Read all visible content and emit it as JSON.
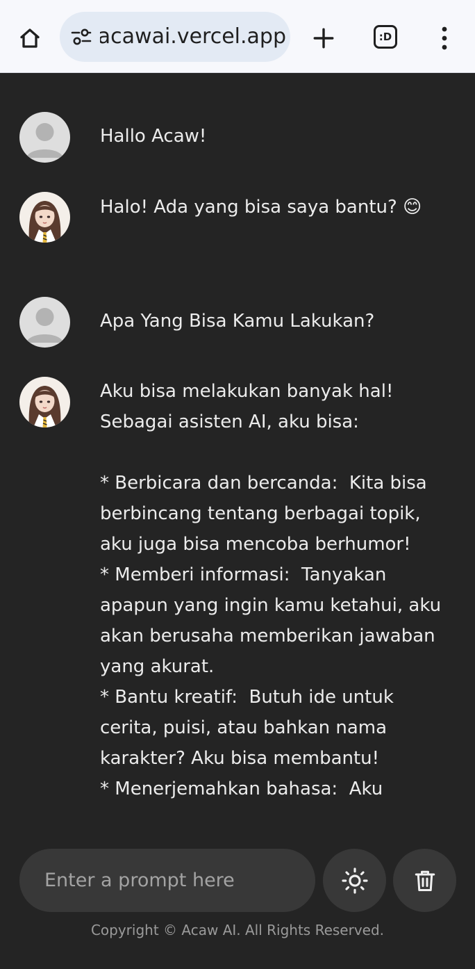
{
  "browser": {
    "url": "acawai.vercel.app",
    "tabs_label": ":D"
  },
  "chat": {
    "messages": [
      {
        "role": "user",
        "text": "Hallo Acaw!"
      },
      {
        "role": "assistant",
        "text": "Halo! Ada yang bisa saya bantu? 😊"
      },
      {
        "role": "user",
        "text": "Apa Yang Bisa Kamu Lakukan?"
      },
      {
        "role": "assistant",
        "text": "Aku bisa melakukan banyak hal! Sebagai asisten AI, aku bisa:\n\n* Berbicara dan bercanda:  Kita bisa berbincang tentang berbagai topik, aku juga bisa mencoba berhumor!\n* Memberi informasi:  Tanyakan apapun yang ingin kamu ketahui, aku akan berusaha memberikan jawaban yang akurat.\n* Bantu kreatif:  Butuh ide untuk cerita, puisi, atau bahkan nama karakter? Aku bisa membantu!\n* Menerjemahkan bahasa:  Aku"
      }
    ]
  },
  "input": {
    "placeholder": "Enter a prompt here"
  },
  "footer": {
    "copyright": "Copyright © Acaw AI. All Rights Reserved."
  },
  "icons": {
    "home": "home-icon",
    "site_settings": "tune-icon",
    "new_tab": "plus-icon",
    "tabs": "tab-switcher-icon",
    "menu": "more-vertical-icon",
    "theme": "sun-icon",
    "delete": "trash-icon"
  },
  "colors": {
    "background": "#242424",
    "input_background": "#383838",
    "text": "#ececec",
    "browser_bar": "#f7f8fc",
    "url_pill": "#e3eaf4"
  }
}
